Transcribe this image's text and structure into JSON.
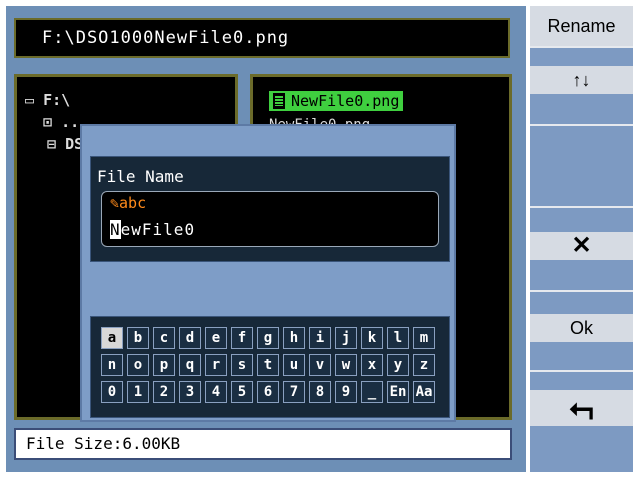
{
  "path": "F:\\DSO1000NewFile0.png",
  "tree": {
    "root": "F:\\",
    "parent": "..",
    "folder": "DS"
  },
  "files": {
    "selected": "NewFile0.png",
    "faint": "NewFile0.png"
  },
  "file_size": "File Size:6.00KB",
  "dialog": {
    "label": "File Name",
    "mode": "abc",
    "value_cursor": "N",
    "value_rest": "ewFile0",
    "keyboard_rows": [
      [
        "a",
        "b",
        "c",
        "d",
        "e",
        "f",
        "g",
        "h",
        "i",
        "j",
        "k",
        "l",
        "m"
      ],
      [
        "n",
        "o",
        "p",
        "q",
        "r",
        "s",
        "t",
        "u",
        "v",
        "w",
        "x",
        "y",
        "z"
      ],
      [
        "0",
        "1",
        "2",
        "3",
        "4",
        "5",
        "6",
        "7",
        "8",
        "9",
        "_",
        "En",
        "Aa"
      ]
    ]
  },
  "softkeys": {
    "title": "Rename",
    "arrows": "↑↓",
    "delete": "✕",
    "ok": "Ok",
    "back": "⮢"
  }
}
